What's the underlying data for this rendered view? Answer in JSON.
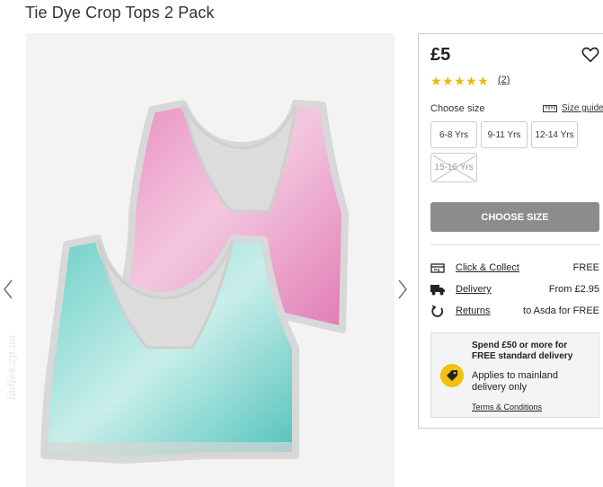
{
  "product": {
    "title": "Tie Dye Crop Tops 2 Pack",
    "price": "£5",
    "rating_stars": "★★★★★",
    "review_count": "(2)"
  },
  "gallery": {
    "watermark": "ladies.zp.ua",
    "prev_icon": "chevron-left-icon",
    "next_icon": "chevron-right-icon"
  },
  "sizes": {
    "label": "Choose size",
    "guide_label": "Size guide",
    "options": [
      {
        "label": "6-8 Yrs",
        "available": true
      },
      {
        "label": "9-11 Yrs",
        "available": true
      },
      {
        "label": "12-14 Yrs",
        "available": true
      },
      {
        "label": "15-16 Yrs",
        "available": false
      }
    ]
  },
  "cta": {
    "label": "CHOOSE SIZE"
  },
  "delivery": [
    {
      "icon": "store-icon",
      "link": "Click & Collect",
      "value": "FREE"
    },
    {
      "icon": "truck-icon",
      "link": "Delivery",
      "value": "From £2.95"
    },
    {
      "icon": "returns-icon",
      "link": "Returns",
      "value": "to Asda for FREE"
    }
  ],
  "promo": {
    "heading": "Spend £50 or more for FREE standard delivery",
    "body": "Applies to mainland delivery only",
    "terms": "Terms & Conditions"
  },
  "colors": {
    "star": "#f2b705",
    "cta_bg": "#8c8c8c",
    "promo_badge": "#f2c10d",
    "pink_top": "#e68fc1",
    "teal_top": "#79d1cc"
  }
}
